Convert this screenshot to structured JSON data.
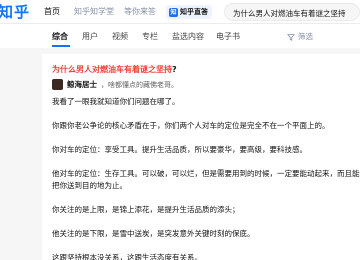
{
  "header": {
    "logo": "知乎",
    "nav": [
      "首页",
      "知乎知学堂",
      "等你来答"
    ],
    "zhida_badge": "知",
    "zhida_label": "知乎直答",
    "search_value": "为什么男人对燃油车有着谜之坚持"
  },
  "tabs": {
    "items": [
      "综合",
      "用户",
      "视频",
      "专栏",
      "盐选内容",
      "电子书"
    ],
    "active": "综合",
    "filter_label": "筛选"
  },
  "result": {
    "title_highlight": "为什么男人对燃油车有着谜之坚持",
    "title_suffix": "?",
    "author_name": "鲸海居士",
    "author_bio": "，啥都懂点的藏佛老哥。",
    "paragraphs": [
      "我看了一眼我就知道你们问题在哪了。",
      "你跟你老公争论的核心矛盾在于，你们两个人对车的定位是完全不在一个平面上的。",
      "你对车的定位：享受工具。提升生活品质，所以要豪华，要高级，要科技感。",
      "他对车的定位：生存工具。可以破，可以烂，但是需要用到的时候，一定要能动起来，而且能动到",
      "把你送到目的地为止。",
      "你关注的是上限，是锦上添花，是提升生活品质的添头；",
      "他关注的是下限，是雪中送炭，是突发意外关键时刻的保底。",
      "这跟坚持根本没关系，这跟生活态度有关系。"
    ]
  },
  "colors": {
    "brand": "#1772f6",
    "highlight": "#f1403c"
  }
}
